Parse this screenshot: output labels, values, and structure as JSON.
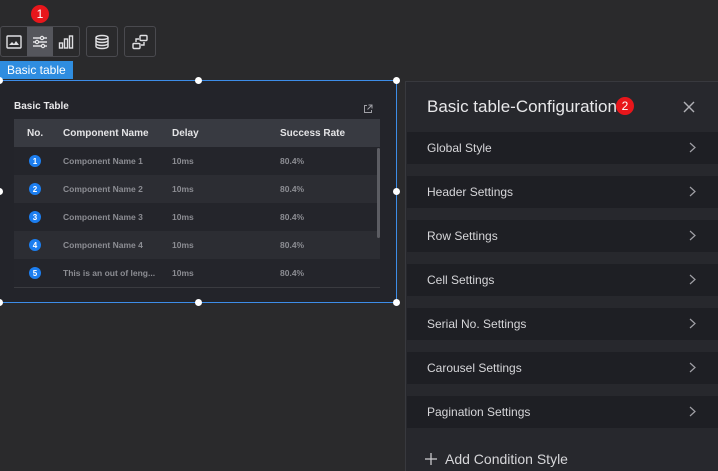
{
  "badges": {
    "toolbar": "1",
    "panel": "2"
  },
  "component_tag": "Basic table",
  "widget": {
    "title": "Basic Table",
    "columns": [
      "No.",
      "Component Name",
      "Delay",
      "Success Rate"
    ],
    "rows": [
      {
        "no": "1",
        "name": "Component Name 1",
        "delay": "10ms",
        "rate": "80.4%"
      },
      {
        "no": "2",
        "name": "Component Name 2",
        "delay": "10ms",
        "rate": "80.4%"
      },
      {
        "no": "3",
        "name": "Component Name 3",
        "delay": "10ms",
        "rate": "80.4%"
      },
      {
        "no": "4",
        "name": "Component Name 4",
        "delay": "10ms",
        "rate": "80.4%"
      },
      {
        "no": "5",
        "name": "This is an out of leng...",
        "delay": "10ms",
        "rate": "80.4%"
      }
    ]
  },
  "panel": {
    "title": "Basic table-Configuration",
    "sections": [
      "Global Style",
      "Header Settings",
      "Row Settings",
      "Cell Settings",
      "Serial No. Settings",
      "Carousel Settings",
      "Pagination Settings"
    ],
    "add_condition": "Add Condition Style"
  },
  "colors": {
    "accent": "#2f8de0",
    "badge": "#e8161b",
    "number_dot": "#1c7ef0"
  }
}
